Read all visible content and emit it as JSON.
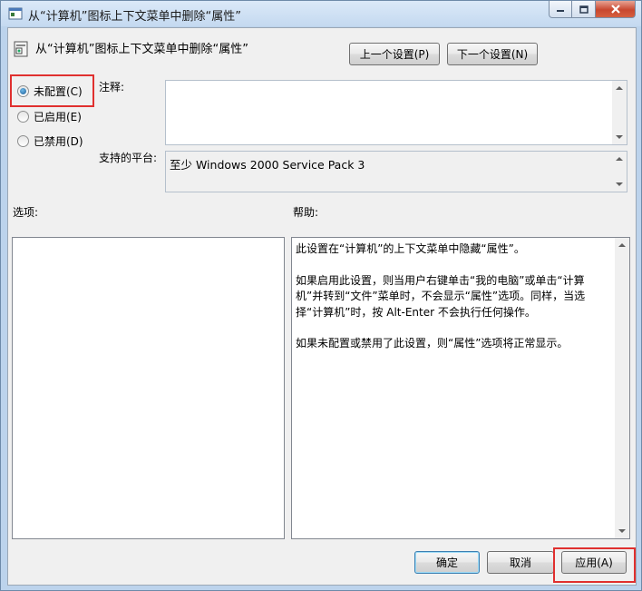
{
  "window": {
    "title": "从“计算机”图标上下文菜单中删除“属性”"
  },
  "header": {
    "title": "从“计算机”图标上下文菜单中删除“属性”",
    "prev_button": "上一个设置(P)",
    "next_button": "下一个设置(N)"
  },
  "state_options": [
    {
      "label": "未配置(C)",
      "selected": true
    },
    {
      "label": "已启用(E)",
      "selected": false
    },
    {
      "label": "已禁用(D)",
      "selected": false
    }
  ],
  "comment": {
    "label": "注释:",
    "value": ""
  },
  "platform": {
    "label": "支持的平台:",
    "value": "至少 Windows 2000 Service Pack 3"
  },
  "options": {
    "label": "选项:"
  },
  "help": {
    "label": "帮助:",
    "paragraphs": [
      "此设置在“计算机”的上下文菜单中隐藏“属性”。",
      "如果启用此设置，则当用户右键单击“我的电脑”或单击“计算机”并转到“文件”菜单时，不会显示“属性”选项。同样，当选择“计算机”时，按 Alt-Enter 不会执行任何操作。",
      "如果未配置或禁用了此设置，则“属性”选项将正常显示。"
    ]
  },
  "footer": {
    "ok": "确定",
    "cancel": "取消",
    "apply": "应用(A)"
  },
  "colors": {
    "highlight": "#e0302f",
    "selected_radio": "#1f5d96"
  }
}
